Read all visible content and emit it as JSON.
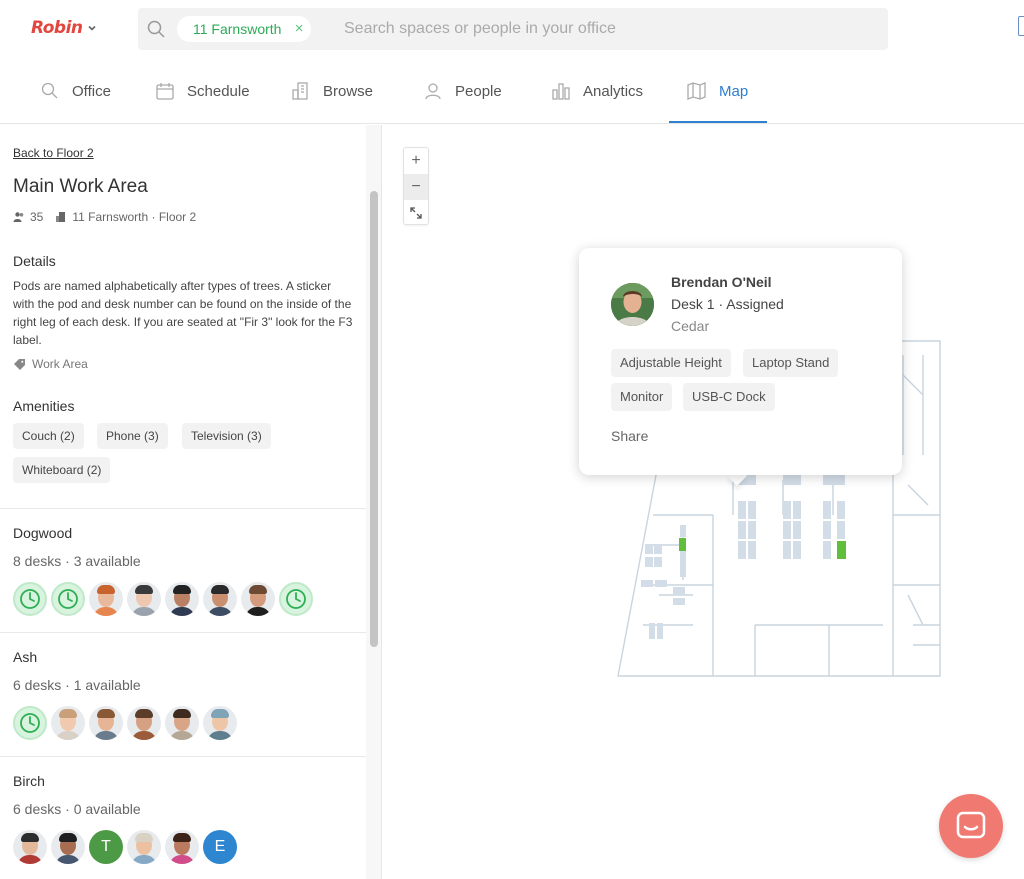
{
  "brand": {
    "name": "Robin"
  },
  "search": {
    "location_chip": "11 Farnsworth",
    "chip_remove": "×",
    "placeholder": "Search spaces or people in your office"
  },
  "nav": {
    "tabs": [
      {
        "label": "Office",
        "icon": "search-icon"
      },
      {
        "label": "Schedule",
        "icon": "calendar-icon"
      },
      {
        "label": "Browse",
        "icon": "building-icon"
      },
      {
        "label": "People",
        "icon": "person-icon"
      },
      {
        "label": "Analytics",
        "icon": "bar-chart-icon"
      },
      {
        "label": "Map",
        "icon": "map-icon",
        "active": true
      }
    ]
  },
  "sidebar": {
    "back_link": "Back to Floor 2",
    "title": "Main Work Area",
    "capacity": "35",
    "location": "11 Farnsworth · Floor 2",
    "details_heading": "Details",
    "details_text": "Pods are named alphabetically after types of trees. A sticker with the pod and desk number can be found on the inside of the right leg of each desk. If you are seated at \"Fir 3\" look for the F3 label.",
    "tag": "Work Area",
    "amenities_heading": "Amenities",
    "amenities": [
      "Couch (2)",
      "Phone (3)",
      "Television (3)",
      "Whiteboard (2)"
    ],
    "pods": [
      {
        "name": "Dogwood",
        "summary": "8 desks · 3 available",
        "occupants": [
          {
            "type": "available"
          },
          {
            "type": "available"
          },
          {
            "type": "photo",
            "skin": "#e9b99b",
            "hair": "#c9632e",
            "shirt": "#e7854e"
          },
          {
            "type": "photo",
            "skin": "#eec7b0",
            "hair": "#3a3a3a",
            "shirt": "#9aa3ad"
          },
          {
            "type": "photo",
            "skin": "#b98064",
            "hair": "#222222",
            "shirt": "#2f3b52"
          },
          {
            "type": "photo",
            "skin": "#c98f6f",
            "hair": "#2a2a2a",
            "shirt": "#3d4d63"
          },
          {
            "type": "photo",
            "skin": "#d39a7c",
            "hair": "#6e4a34",
            "shirt": "#1f1f1f"
          },
          {
            "type": "available"
          }
        ]
      },
      {
        "name": "Ash",
        "summary": "6 desks · 1 available",
        "occupants": [
          {
            "type": "available"
          },
          {
            "type": "photo",
            "skin": "#f0c9ae",
            "hair": "#c9a079",
            "shirt": "#d9d0c6"
          },
          {
            "type": "photo",
            "skin": "#e7b595",
            "hair": "#8a5a36",
            "shirt": "#6a7b8d"
          },
          {
            "type": "photo",
            "skin": "#d6a182",
            "hair": "#5c3d29",
            "shirt": "#9b5c3c"
          },
          {
            "type": "photo",
            "skin": "#d9a587",
            "hair": "#3e2b1f",
            "shirt": "#b5a796"
          },
          {
            "type": "photo",
            "skin": "#eec6a7",
            "hair": "#7fa3b7",
            "shirt": "#5e7e8f"
          }
        ]
      },
      {
        "name": "Birch",
        "summary": "6 desks · 0 available",
        "occupants": [
          {
            "type": "photo",
            "skin": "#e4b89a",
            "hair": "#2d2d2d",
            "shirt": "#b13a35"
          },
          {
            "type": "photo",
            "skin": "#a86d50",
            "hair": "#1f1f1f",
            "shirt": "#46576f"
          },
          {
            "type": "letter",
            "letter": "T",
            "color": "#4c9a46"
          },
          {
            "type": "photo",
            "skin": "#ecc1a2",
            "hair": "#d9d2c4",
            "shirt": "#86a9c6"
          },
          {
            "type": "photo",
            "skin": "#b97a5f",
            "hair": "#3b2318",
            "shirt": "#d14d8a"
          },
          {
            "type": "letter",
            "letter": "E",
            "color": "#2f86d0"
          }
        ]
      }
    ]
  },
  "map": {
    "zoom_in": "+",
    "zoom_out": "−",
    "fullscreen_icon": "expand-icon"
  },
  "popup": {
    "name": "Brendan O'Neil",
    "desk": "Desk 1 · Assigned",
    "pod": "Cedar",
    "features": [
      "Adjustable Height",
      "Laptop Stand",
      "Monitor",
      "USB-C Dock"
    ],
    "share": "Share"
  },
  "colors": {
    "brand": "#e2463f",
    "active_tab": "#2d7fd0",
    "chip_text": "#2daa57",
    "available_desk": "#5fbf3c",
    "chat_button": "#f07a72"
  }
}
